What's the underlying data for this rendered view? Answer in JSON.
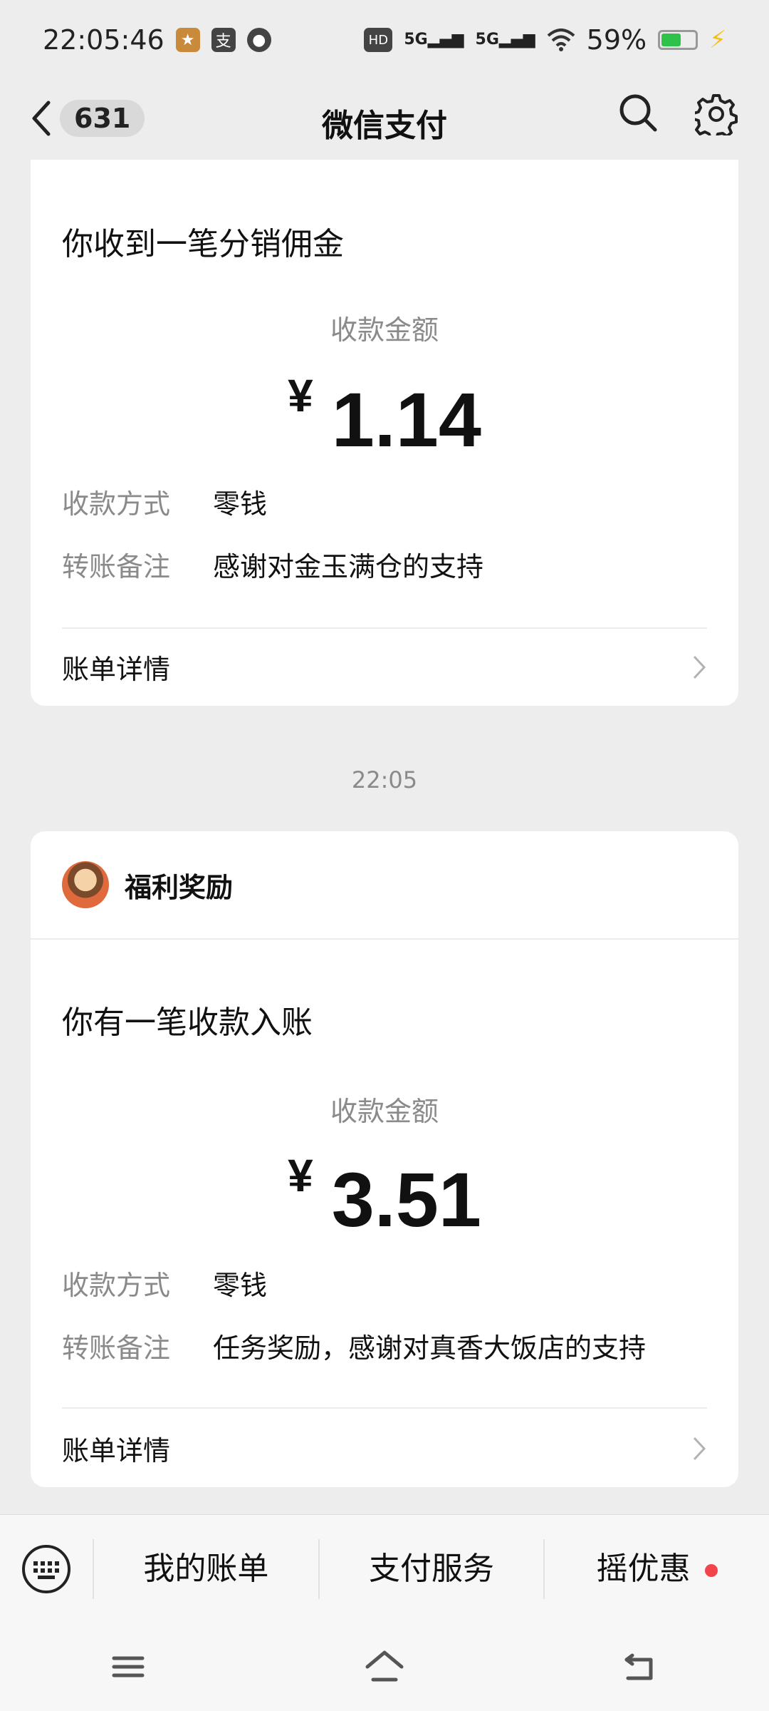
{
  "status_bar": {
    "time": "22:05:46",
    "network1": "5G",
    "network2": "5G",
    "battery": "59%",
    "battery_fraction": 0.59
  },
  "nav": {
    "back_count": "631",
    "title": "微信支付"
  },
  "messages": [
    {
      "heading": "你收到一笔分销佣金",
      "amount_label": "收款金额",
      "currency": "¥",
      "amount": "1.14",
      "method_key": "收款方式",
      "method_value": "零钱",
      "note_key": "转账备注",
      "note_value": "感谢对金玉满仓的支持",
      "detail_label": "账单详情"
    },
    {
      "sender": "福利奖励",
      "heading": "你有一笔收款入账",
      "amount_label": "收款金额",
      "currency": "¥",
      "amount": "3.51",
      "method_key": "收款方式",
      "method_value": "零钱",
      "note_key": "转账备注",
      "note_value": "任务奖励，感谢对真香大饭店的支持",
      "detail_label": "账单详情"
    }
  ],
  "time_separator": "22:05",
  "bottom_menu": {
    "item1": "我的账单",
    "item2": "支付服务",
    "item3": "摇优惠"
  },
  "icons": {
    "back": "chevron-left-icon",
    "search": "search-icon",
    "settings": "gear-icon",
    "keyboard": "keyboard-icon"
  }
}
